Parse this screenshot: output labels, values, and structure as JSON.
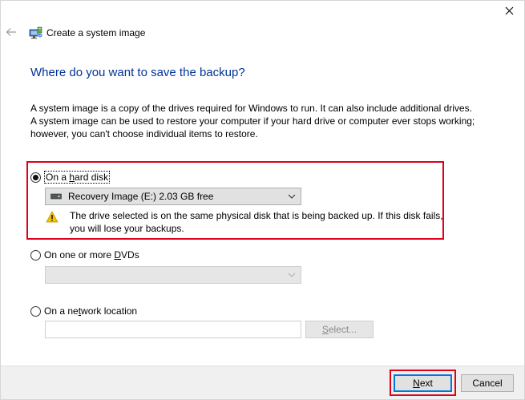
{
  "window": {
    "title": "Create a system image",
    "close_icon": "close-icon",
    "back_icon": "back-arrow-icon",
    "app_icon": "system-image-icon"
  },
  "main": {
    "heading": "Where do you want to save the backup?",
    "description": "A system image is a copy of the drives required for Windows to run. It can also include additional drives. A system image can be used to restore your computer if your hard drive or computer ever stops working; however, you can't choose individual items to restore."
  },
  "options": {
    "hard_disk": {
      "label_prefix": "On a ",
      "label_underlined": "h",
      "label_suffix": "ard disk",
      "selected": true,
      "drive_value": "Recovery Image (E:)  2.03 GB free",
      "warning": "The drive selected is on the same physical disk that is being backed up. If this disk fails, you will lose your backups."
    },
    "dvd": {
      "label_prefix": "On one or more ",
      "label_underlined": "D",
      "label_suffix": "VDs",
      "selected": false,
      "drive_value": ""
    },
    "network": {
      "label_prefix": "On a ne",
      "label_underlined": "t",
      "label_suffix": "work location",
      "selected": false,
      "location_value": "",
      "select_button_underlined": "S",
      "select_button_suffix": "elect..."
    }
  },
  "footer": {
    "next_underlined": "N",
    "next_suffix": "ext",
    "cancel_label": "Cancel"
  },
  "colors": {
    "heading": "#003399",
    "highlight": "#e0001a",
    "focus_border": "#0078d7",
    "footer_bg": "#f0f0f0"
  }
}
